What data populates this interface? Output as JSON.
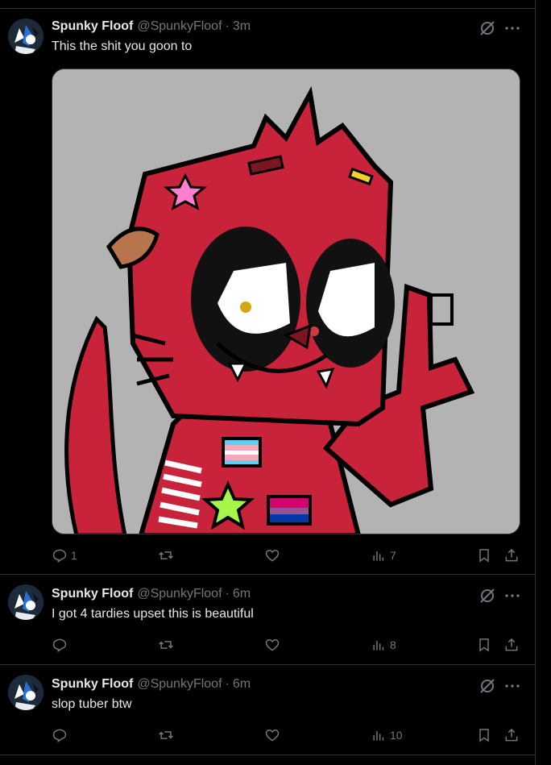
{
  "posts": [
    {
      "name": "Spunky Floof",
      "handle": "@SpunkyFloof",
      "separator": "·",
      "time": "3m",
      "text": "This the shit you goon to",
      "replies": "1",
      "reposts": "",
      "likes": "",
      "views": "7",
      "has_media": true
    },
    {
      "name": "Spunky Floof",
      "handle": "@SpunkyFloof",
      "separator": "·",
      "time": "6m",
      "text": "I got 4 tardies upset this is beautiful",
      "replies": "",
      "reposts": "",
      "likes": "",
      "views": "8",
      "has_media": false
    },
    {
      "name": "Spunky Floof",
      "handle": "@SpunkyFloof",
      "separator": "·",
      "time": "6m",
      "text": "slop tuber btw",
      "replies": "",
      "reposts": "",
      "likes": "",
      "views": "10",
      "has_media": false
    }
  ],
  "colors": {
    "background": "#000000",
    "text_primary": "#e7e9ea",
    "text_secondary": "#71767b",
    "border": "#2f3336",
    "image_background": "#b3b3b3",
    "character_red": "#c8233a"
  },
  "icons": [
    "grok-icon",
    "more-icon",
    "reply-icon",
    "repost-icon",
    "like-icon",
    "views-icon",
    "bookmark-icon",
    "share-icon"
  ]
}
